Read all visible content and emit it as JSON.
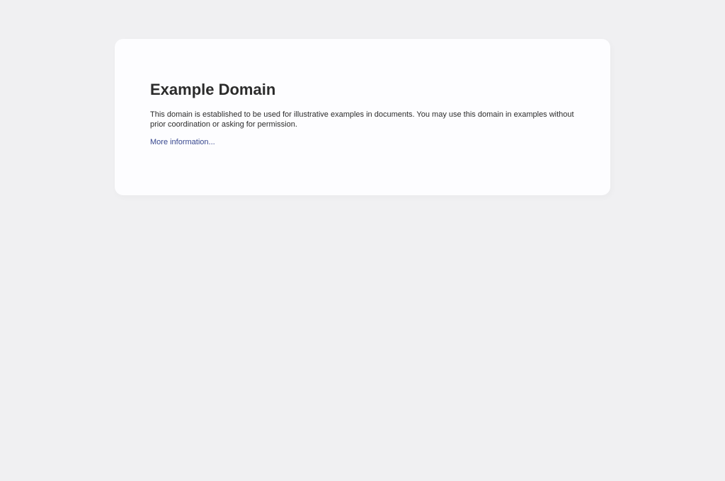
{
  "page": {
    "title": "Example Domain",
    "description": "This domain is established to be used for illustrative examples in documents. You may use this domain in examples without prior coordination or asking for permission.",
    "more_link": "More information..."
  },
  "colors": {
    "background": "#f0f0f2",
    "card": "#fdfdff",
    "text": "#2b2b2b",
    "link": "#38488f"
  }
}
